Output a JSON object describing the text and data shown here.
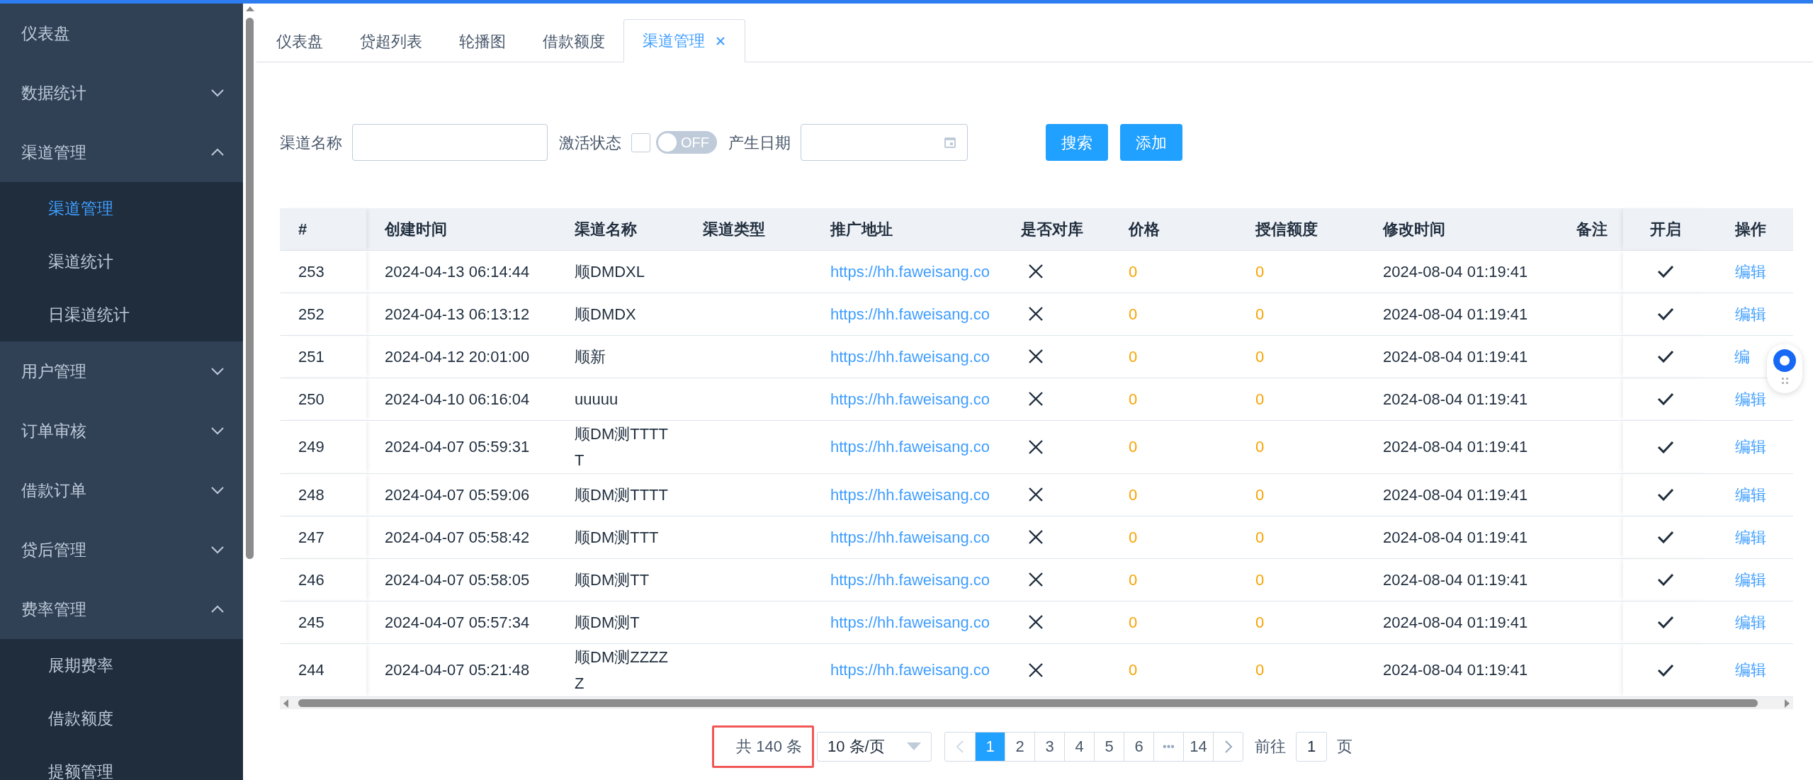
{
  "sidebar": {
    "items": [
      {
        "label": "仪表盘",
        "kind": "link"
      },
      {
        "label": "数据统计",
        "kind": "submenu",
        "expanded": false
      },
      {
        "label": "渠道管理",
        "kind": "submenu",
        "expanded": true,
        "children": [
          {
            "label": "渠道管理",
            "selected": true
          },
          {
            "label": "渠道统计",
            "selected": false
          },
          {
            "label": "日渠道统计",
            "selected": false
          }
        ]
      },
      {
        "label": "用户管理",
        "kind": "submenu",
        "expanded": false
      },
      {
        "label": "订单审核",
        "kind": "submenu",
        "expanded": false
      },
      {
        "label": "借款订单",
        "kind": "submenu",
        "expanded": false
      },
      {
        "label": "贷后管理",
        "kind": "submenu",
        "expanded": false
      },
      {
        "label": "费率管理",
        "kind": "submenu",
        "expanded": true,
        "children": [
          {
            "label": "展期费率",
            "selected": false
          },
          {
            "label": "借款额度",
            "selected": false
          },
          {
            "label": "提额管理",
            "selected": false
          }
        ]
      }
    ]
  },
  "tabs": [
    {
      "label": "仪表盘",
      "selected": false
    },
    {
      "label": "贷超列表",
      "selected": false
    },
    {
      "label": "轮播图",
      "selected": false
    },
    {
      "label": "借款额度",
      "selected": false
    },
    {
      "label": "渠道管理",
      "selected": true
    }
  ],
  "filters": {
    "name_label": "渠道名称",
    "status_label": "激活状态",
    "status_checked": false,
    "switch_on": false,
    "switch_text": "OFF",
    "date_label": "产生日期",
    "buttons": [
      "搜索",
      "添加"
    ]
  },
  "table": {
    "columns": [
      "#",
      "创建时间",
      "渠道名称",
      "渠道类型",
      "推广地址",
      "是否对库",
      "价格",
      "授信额度",
      "修改时间",
      "备注",
      "开启",
      "操作"
    ],
    "rows": [
      {
        "id": "253",
        "created": "2024-04-13 06:14:44",
        "name": "顺DMDXL",
        "url": "https://hh.faweisang.co",
        "matched": false,
        "price": "0",
        "credit": "0",
        "modified": "2024-08-04 01:19:41",
        "enabled": true,
        "action": "编辑"
      },
      {
        "id": "252",
        "created": "2024-04-13 06:13:12",
        "name": "顺DMDX",
        "url": "https://hh.faweisang.co",
        "matched": false,
        "price": "0",
        "credit": "0",
        "modified": "2024-08-04 01:19:41",
        "enabled": true,
        "action": "编辑"
      },
      {
        "id": "251",
        "created": "2024-04-12 20:01:00",
        "name": "顺新",
        "url": "https://hh.faweisang.co",
        "matched": false,
        "price": "0",
        "credit": "0",
        "modified": "2024-08-04 01:19:41",
        "enabled": true,
        "action": "编"
      },
      {
        "id": "250",
        "created": "2024-04-10 06:16:04",
        "name": "uuuuu",
        "url": "https://hh.faweisang.co",
        "matched": false,
        "price": "0",
        "credit": "0",
        "modified": "2024-08-04 01:19:41",
        "enabled": true,
        "action": "编辑"
      },
      {
        "id": "249",
        "created": "2024-04-07 05:59:31",
        "name": "顺DM测TTTTT",
        "url": "https://hh.faweisang.co",
        "matched": false,
        "price": "0",
        "credit": "0",
        "modified": "2024-08-04 01:19:41",
        "enabled": true,
        "action": "编辑"
      },
      {
        "id": "248",
        "created": "2024-04-07 05:59:06",
        "name": "顺DM测TTTT",
        "url": "https://hh.faweisang.co",
        "matched": false,
        "price": "0",
        "credit": "0",
        "modified": "2024-08-04 01:19:41",
        "enabled": true,
        "action": "编辑"
      },
      {
        "id": "247",
        "created": "2024-04-07 05:58:42",
        "name": "顺DM测TTT",
        "url": "https://hh.faweisang.co",
        "matched": false,
        "price": "0",
        "credit": "0",
        "modified": "2024-08-04 01:19:41",
        "enabled": true,
        "action": "编辑"
      },
      {
        "id": "246",
        "created": "2024-04-07 05:58:05",
        "name": "顺DM测TT",
        "url": "https://hh.faweisang.co",
        "matched": false,
        "price": "0",
        "credit": "0",
        "modified": "2024-08-04 01:19:41",
        "enabled": true,
        "action": "编辑"
      },
      {
        "id": "245",
        "created": "2024-04-07 05:57:34",
        "name": "顺DM测T",
        "url": "https://hh.faweisang.co",
        "matched": false,
        "price": "0",
        "credit": "0",
        "modified": "2024-08-04 01:19:41",
        "enabled": true,
        "action": "编辑"
      },
      {
        "id": "244",
        "created": "2024-04-07 05:21:48",
        "name": "顺DM测ZZZZZ",
        "url": "https://hh.faweisang.co",
        "matched": false,
        "price": "0",
        "credit": "0",
        "modified": "2024-08-04 01:19:41",
        "enabled": true,
        "action": "编辑"
      }
    ]
  },
  "pagination": {
    "total": "共 140 条",
    "highlighted": true,
    "page_size": "10 条/页",
    "pages": [
      {
        "label": "1",
        "kind": "page",
        "selected": true
      },
      {
        "label": "2",
        "kind": "page",
        "selected": false
      },
      {
        "label": "3",
        "kind": "page",
        "selected": false
      },
      {
        "label": "4",
        "kind": "page",
        "selected": false
      },
      {
        "label": "5",
        "kind": "page",
        "selected": false
      },
      {
        "label": "6",
        "kind": "page",
        "selected": false
      },
      {
        "label": "•••",
        "kind": "ellipsis",
        "selected": false
      },
      {
        "label": "14",
        "kind": "page",
        "selected": false
      }
    ],
    "goto_label": "前往",
    "goto_value": "1",
    "page_suffix": "页"
  }
}
